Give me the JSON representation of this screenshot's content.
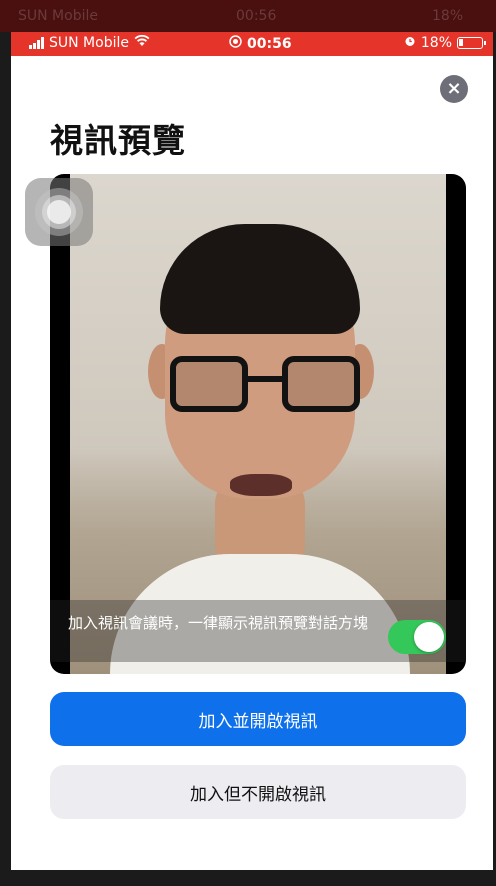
{
  "dim_status": {
    "carrier": "SUN Mobile",
    "time": "00:56",
    "battery": "18%"
  },
  "status_bar": {
    "carrier": "SUN Mobile",
    "time": "00:56",
    "battery": "18%",
    "color": "#e5352b"
  },
  "dialog": {
    "title": "視訊預覽",
    "close_icon": "×",
    "toggle_label": "加入視訊會議時，一律顯示視訊預覽對話方塊",
    "toggle_on": true,
    "join_with_video": "加入並開啟視訊",
    "join_without_video": "加入但不開啟視訊"
  },
  "colors": {
    "primary": "#0e71eb",
    "toggle_on": "#34c759",
    "secondary_bg": "#ececf1"
  }
}
